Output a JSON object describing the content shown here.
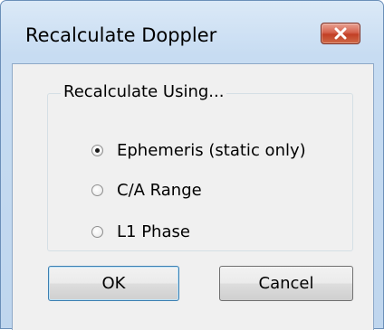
{
  "window": {
    "title": "Recalculate Doppler",
    "close_icon": "close-icon"
  },
  "group": {
    "legend": "Recalculate Using...",
    "options": [
      {
        "label": "Ephemeris (static only)",
        "selected": true
      },
      {
        "label": "C/A Range",
        "selected": false
      },
      {
        "label": "L1 Phase",
        "selected": false
      }
    ]
  },
  "buttons": {
    "ok_label": "OK",
    "cancel_label": "Cancel"
  },
  "colors": {
    "title_gradient": "#c7dcf2",
    "close_button": "#c23f25",
    "client_background": "#f0f0f0",
    "default_button_border": "#3c7fb1"
  }
}
